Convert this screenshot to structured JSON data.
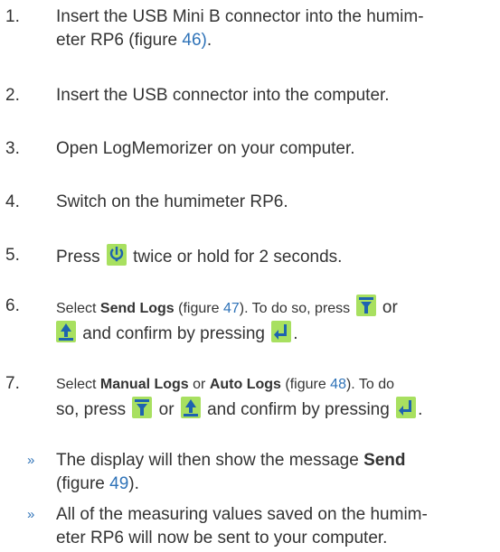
{
  "steps": [
    {
      "num": "1.",
      "a": "Insert the USB Mini B connector into the humim-",
      "b": "eter RP6 (figure ",
      "fig": "46)",
      "c": "."
    },
    {
      "num": "2.",
      "text": "Insert the USB connector into the computer."
    },
    {
      "num": "3.",
      "text": "Open LogMemorizer on your computer."
    },
    {
      "num": "4.",
      "text": "Switch on the humimeter RP6."
    },
    {
      "num": "5.",
      "a": "Press ",
      "b": " twice or hold for 2 seconds."
    },
    {
      "num": "6.",
      "a": "Select ",
      "bold1": "Send Logs",
      "b": " (figure ",
      "fig": "47",
      "c": "). To do so, press ",
      "d": " or",
      "e": " and confirm by pressing ",
      "f": "."
    },
    {
      "num": "7.",
      "a": "Select ",
      "bold1": "Manual Logs",
      "b": " or ",
      "bold2": "Auto Logs",
      "c": " (figure ",
      "fig": "48",
      "d": "). To do",
      "e": "so, press ",
      "f": " or ",
      "g": " and confirm by pressing ",
      "h": "."
    }
  ],
  "bullets": [
    {
      "mark": "»",
      "a": "The display will then show the message ",
      "bold": "Send",
      "b": "(figure ",
      "fig": "49",
      "c": ")."
    },
    {
      "mark": "»",
      "a": "All of the measuring values saved on the humim-",
      "b": "eter RP6 will now be sent to your computer."
    }
  ],
  "icons": {
    "power": "power-icon",
    "down": "down-arrow-icon",
    "up": "up-arrow-icon",
    "enter": "enter-icon"
  },
  "colors": {
    "link": "#2f73b8",
    "icon_bg": "#a8e060",
    "icon_fg": "#1e63b0"
  }
}
